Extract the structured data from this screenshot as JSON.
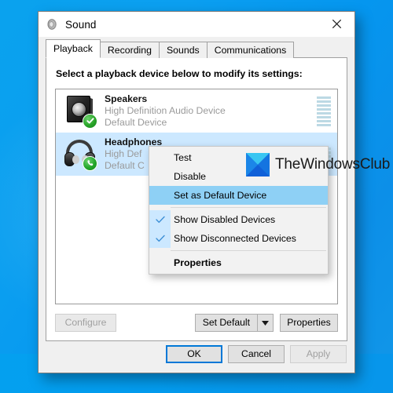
{
  "window": {
    "title": "Sound",
    "icon": "speaker-icon",
    "close_label": "✕"
  },
  "tabs": [
    {
      "label": "Playback",
      "active": true
    },
    {
      "label": "Recording",
      "active": false
    },
    {
      "label": "Sounds",
      "active": false
    },
    {
      "label": "Communications",
      "active": false
    }
  ],
  "playback": {
    "instruction": "Select a playback device below to modify its settings:",
    "devices": [
      {
        "name": "Speakers",
        "driver": "High Definition Audio Device",
        "status": "Default Device",
        "icon": "speaker-icon",
        "badge": "green-check-badge",
        "selected": false,
        "meter_segments": 8
      },
      {
        "name": "Headphones",
        "driver": "High Def",
        "status": "Default C",
        "icon": "headphones-icon",
        "badge": "green-phone-badge",
        "selected": true,
        "meter_segments": 4
      }
    ],
    "buttons": {
      "configure": "Configure",
      "set_default": "Set Default",
      "set_default_arrow": "▼",
      "properties": "Properties"
    }
  },
  "context_menu": {
    "items": [
      {
        "label": "Test",
        "checked": false,
        "highlight": false,
        "bold": false,
        "separator_after": false
      },
      {
        "label": "Disable",
        "checked": false,
        "highlight": false,
        "bold": false,
        "separator_after": false
      },
      {
        "label": "Set as Default Device",
        "checked": false,
        "highlight": true,
        "bold": false,
        "separator_after": true
      },
      {
        "label": "Show Disabled Devices",
        "checked": true,
        "highlight": false,
        "bold": false,
        "separator_after": false
      },
      {
        "label": "Show Disconnected Devices",
        "checked": true,
        "highlight": false,
        "bold": false,
        "separator_after": true
      },
      {
        "label": "Properties",
        "checked": false,
        "highlight": false,
        "bold": true,
        "separator_after": false
      }
    ],
    "checkmark": "✓",
    "highlight_color": "#8ed0f5",
    "check_bg_color": "#cce8ff"
  },
  "footer": {
    "ok": "OK",
    "cancel": "Cancel",
    "apply": "Apply"
  },
  "watermark": {
    "text": "TheWindowsClub",
    "logo": "hourglass-logo"
  },
  "colors": {
    "accent": "#0078d7",
    "selection": "#cce8ff",
    "menu_highlight": "#8ed0f5",
    "desktop": "#0a9fee",
    "meter": "#bcd9e4"
  }
}
